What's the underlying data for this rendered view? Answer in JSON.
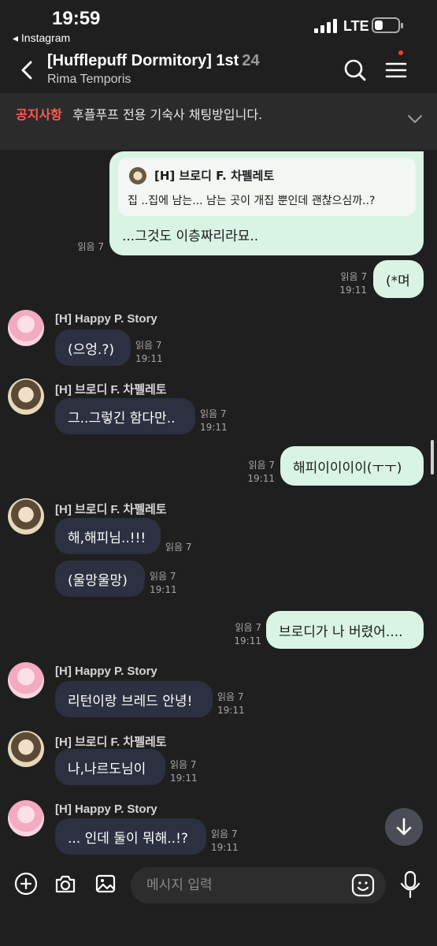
{
  "status": {
    "time": "19:59",
    "back_app": "◂ Instagram",
    "network": "LTE"
  },
  "header": {
    "title": "[Hufflepuff Dormitory] 1st",
    "member_count": "24",
    "subtitle": "Rima Temporis"
  },
  "notice": {
    "label": "공지사항",
    "text": "후플푸프 전용 기숙사 채팅방입니다."
  },
  "reply": {
    "name": "[H] 브로디 F. 차펠레토",
    "quote": "집 ..집에 남는... 남는 곳이 개집 뿐인데 괜찮으심까..?",
    "text": "...그것도 이층짜리라묘..",
    "read": "읽음 7"
  },
  "messages": [
    {
      "read": "읽음 7",
      "time": "19:11",
      "text": "(*며"
    },
    {
      "sender": "[H] Happy P. Story",
      "text": "(으엉.?)",
      "read": "읽음 7",
      "time": "19:11"
    },
    {
      "sender": "[H] 브로디 F. 차펠레토",
      "text": "그..그렇긴 함다만..",
      "read": "읽음 7",
      "time": "19:11"
    },
    {
      "read": "읽음 7",
      "time": "19:11",
      "text": "해피이이이이(ㅜㅜ)"
    },
    {
      "sender": "[H] 브로디 F. 차펠레토",
      "text": "해,해피님..!!!",
      "read": "읽음 7"
    },
    {
      "text": "(울망울망)",
      "read": "읽음 7",
      "time": "19:11"
    },
    {
      "read": "읽음 7",
      "time": "19:11",
      "text": "브로디가 나 버렸어...."
    },
    {
      "sender": "[H] Happy P. Story",
      "text": "리턴이랑 브레드 안녕!",
      "read": "읽음 7",
      "time": "19:11"
    },
    {
      "sender": "[H] 브로디 F. 차펠레토",
      "text": "나,나르도님이",
      "read": "읽음 7",
      "time": "19:11"
    },
    {
      "sender": "[H] Happy P. Story",
      "text": "... 인데 둘이 뭐해..!?",
      "read": "읽음 7",
      "time": "19:11"
    }
  ],
  "input": {
    "placeholder": "메시지 입력"
  },
  "icons": [
    "back-icon",
    "search-icon",
    "menu-icon",
    "chevron-down-icon",
    "arrow-down-icon",
    "plus-icon",
    "camera-icon",
    "image-icon",
    "emoji-icon",
    "mic-icon"
  ],
  "colors": {
    "background": "#1f1f1f",
    "outgoing_bubble": "#d9f4e4",
    "incoming_bubble": "#2c3040",
    "notice_label": "#ff5a4e",
    "badge_dot": "#ff3b30"
  }
}
